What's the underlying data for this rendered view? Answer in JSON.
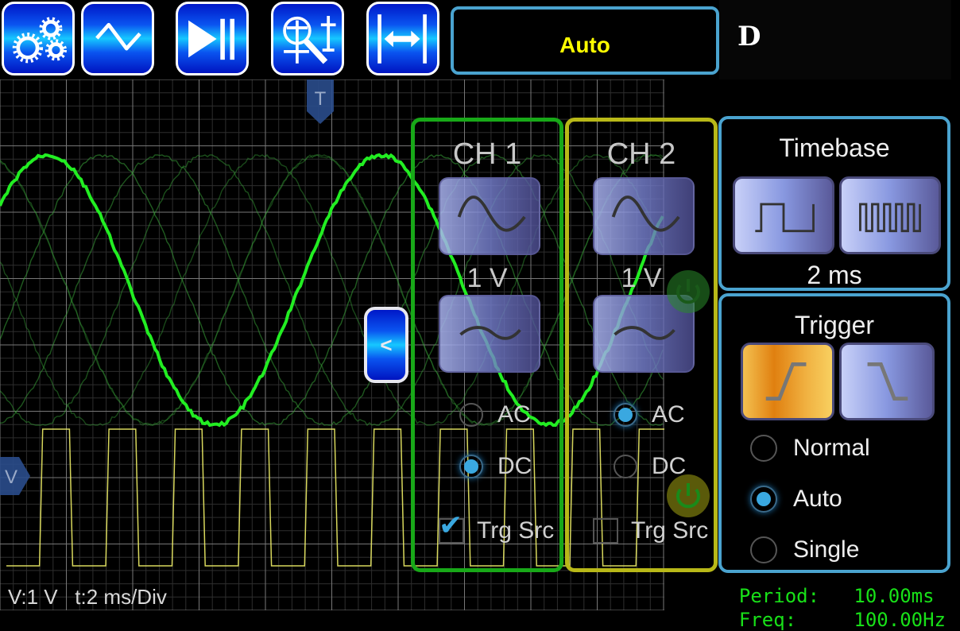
{
  "toolbar": {
    "buttons": [
      {
        "name": "settings",
        "icon": "gears-icon"
      },
      {
        "name": "waveform",
        "icon": "sine-wave-icon"
      },
      {
        "name": "run-stop",
        "icon": "play-pause-icon"
      },
      {
        "name": "measure-zoom",
        "icon": "cursor-magnifier-icon"
      },
      {
        "name": "fit-width",
        "icon": "horizontal-fit-icon"
      }
    ],
    "mode_label": "Auto",
    "d_label": "D"
  },
  "scope": {
    "trigger_marker_label": "T",
    "voltage_marker_label": "V",
    "collapse_label": "<",
    "status_text": "V:1 V   t:2 ms/Div",
    "colors": {
      "ch1": "#22ee22",
      "ch2": "#eeee66",
      "grid_major": "#777777",
      "grid_minor": "#2e2e2e"
    }
  },
  "channels": [
    {
      "title": "CH 1",
      "volts_per_div": "1 V",
      "coupling_options": [
        "AC",
        "DC"
      ],
      "coupling_selected": "DC",
      "trigger_source_label": "Trg Src",
      "trigger_source_checked": true,
      "border_color": "#18a818",
      "power_color": "#2a8a2a"
    },
    {
      "title": "CH 2",
      "volts_per_div": "1 V",
      "coupling_options": [
        "AC",
        "DC"
      ],
      "coupling_selected": "AC",
      "trigger_source_label": "Trg Src",
      "trigger_source_checked": false,
      "border_color": "#b8b818",
      "power_color": "#8a8a10"
    }
  ],
  "timebase": {
    "title": "Timebase",
    "value": "2 ms"
  },
  "trigger": {
    "title": "Trigger",
    "edge_selected": "rising",
    "modes": [
      "Normal",
      "Auto",
      "Single"
    ],
    "mode_selected": "Auto"
  },
  "measurements": {
    "period_label": "Period:",
    "period_value": "10.00ms",
    "freq_label": "Freq:",
    "freq_value": "100.00Hz"
  }
}
